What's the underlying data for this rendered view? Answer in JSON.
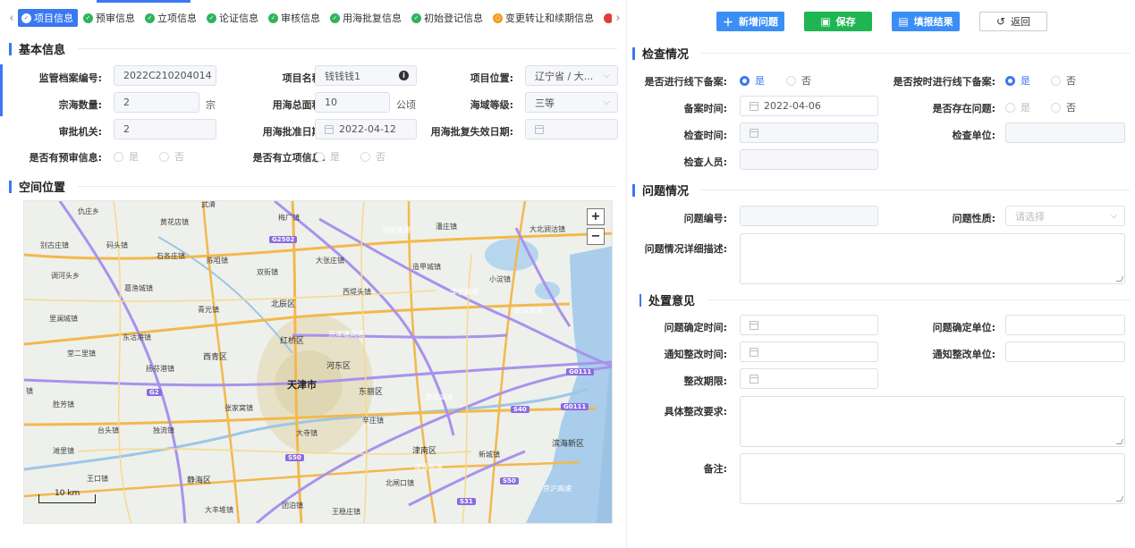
{
  "tabs": [
    {
      "label": "项目信息",
      "icon": "check-circle-icon",
      "active": true
    },
    {
      "label": "预审信息",
      "icon": "check-circle-icon"
    },
    {
      "label": "立项信息",
      "icon": "check-circle-icon"
    },
    {
      "label": "论证信息",
      "icon": "check-circle-icon"
    },
    {
      "label": "审核信息",
      "icon": "check-circle-icon"
    },
    {
      "label": "用海批复信息",
      "icon": "check-circle-icon"
    },
    {
      "label": "初始登记信息",
      "icon": "check-circle-icon"
    },
    {
      "label": "变更转让和续期信息",
      "icon": "pending-circle-icon"
    }
  ],
  "basic": {
    "title": "基本信息",
    "archive_no_label": "监管档案编号:",
    "archive_no": "2022C210204014",
    "project_name_label": "项目名称:",
    "project_name": "钱钱钱1",
    "location_label": "项目位置:",
    "location": "辽宁省 / 大...",
    "count_label": "宗海数量:",
    "count": "2",
    "count_unit": "宗",
    "area_label": "用海总面积:",
    "area": "10",
    "area_unit": "公顷",
    "grade_label": "海域等级:",
    "grade": "三等",
    "authority_label": "审批机关:",
    "authority": "2",
    "approve_date_label": "用海批准日期:",
    "approve_date": "2022-04-12",
    "expire_date_label": "用海批复失效日期:",
    "expire_date": "",
    "has_preview_label": "是否有预审信息:",
    "has_project_label": "是否有立项信息:",
    "yes": "是",
    "no": "否"
  },
  "space": {
    "title": "空间位置",
    "scale_label": "10 km",
    "zoom_in": "+",
    "zoom_out": "−",
    "places": [
      {
        "t": "武清",
        "cls": ""
      },
      {
        "t": "仇庄乡",
        "cls": ""
      },
      {
        "t": "黄花店镇",
        "cls": ""
      },
      {
        "t": "梅厂镇",
        "cls": ""
      },
      {
        "t": "潘庄镇",
        "cls": ""
      },
      {
        "t": "大北涧沽镇",
        "cls": ""
      },
      {
        "t": "别古庄镇",
        "cls": ""
      },
      {
        "t": "码头镇",
        "cls": ""
      },
      {
        "t": "石各庄镇",
        "cls": ""
      },
      {
        "t": "陈咀镇",
        "cls": ""
      },
      {
        "t": "大张庄镇",
        "cls": ""
      },
      {
        "t": "造甲城镇",
        "cls": ""
      },
      {
        "t": "调河头乡",
        "cls": ""
      },
      {
        "t": "双街镇",
        "cls": ""
      },
      {
        "t": "葛渔城镇",
        "cls": ""
      },
      {
        "t": "小淀镇",
        "cls": ""
      },
      {
        "t": "西堤头镇",
        "cls": ""
      },
      {
        "t": "北辰区",
        "cls": "district"
      },
      {
        "t": "青光镇",
        "cls": ""
      },
      {
        "t": "里澜城镇",
        "cls": ""
      },
      {
        "t": "东沽港镇",
        "cls": ""
      },
      {
        "t": "红桥区",
        "cls": "district"
      },
      {
        "t": "堂二里镇",
        "cls": ""
      },
      {
        "t": "西青区",
        "cls": "district"
      },
      {
        "t": "河东区",
        "cls": "district"
      },
      {
        "t": "扬芬港镇",
        "cls": ""
      },
      {
        "t": "天津市",
        "cls": "city"
      },
      {
        "t": "东丽区",
        "cls": "district"
      },
      {
        "t": "胜芳镇",
        "cls": ""
      },
      {
        "t": "张家窝镇",
        "cls": ""
      },
      {
        "t": "辛庄镇",
        "cls": ""
      },
      {
        "t": "台头镇",
        "cls": ""
      },
      {
        "t": "独流镇",
        "cls": ""
      },
      {
        "t": "大寺镇",
        "cls": ""
      },
      {
        "t": "滨海新区",
        "cls": "district"
      },
      {
        "t": "津南区",
        "cls": "district"
      },
      {
        "t": "新城镇",
        "cls": ""
      },
      {
        "t": "滩里镇",
        "cls": ""
      },
      {
        "t": "王口镇",
        "cls": ""
      },
      {
        "t": "静海区",
        "cls": "district"
      },
      {
        "t": "北闸口镇",
        "cls": ""
      },
      {
        "t": "大丰堆镇",
        "cls": ""
      },
      {
        "t": "团泊镇",
        "cls": ""
      },
      {
        "t": "王稳庄镇",
        "cls": ""
      },
      {
        "t": "镇",
        "cls": ""
      }
    ],
    "shields": [
      "G2502",
      "G0111",
      "G2",
      "G0111",
      "S40",
      "S50",
      "S50",
      "S31"
    ],
    "road_labels": [
      "滨保高速",
      "津宁高速",
      "长深高速",
      "京津塘高速",
      "津滨高速",
      "津晋高速",
      "京沪高速"
    ]
  },
  "toolbar": {
    "add_label": "新增问题",
    "save_label": "保存",
    "report_label": "填报结果",
    "back_label": "返回"
  },
  "inspect": {
    "title": "检查情况",
    "offline_label": "是否进行线下备案:",
    "ontime_label": "是否按时进行线下备案:",
    "record_time_label": "备案时间:",
    "record_time": "2022-04-06",
    "has_problem_label": "是否存在问题:",
    "check_time_label": "检查时间:",
    "check_unit_label": "检查单位:",
    "checker_label": "检查人员:",
    "yes": "是",
    "no": "否"
  },
  "problem": {
    "title": "问题情况",
    "no_label": "问题编号:",
    "nature_label": "问题性质:",
    "nature_placeholder": "请选择",
    "desc_label": "问题情况详细描述:"
  },
  "handle": {
    "title": "处置意见",
    "confirm_time_label": "问题确定时间:",
    "confirm_unit_label": "问题确定单位:",
    "notify_time_label": "通知整改时间:",
    "notify_unit_label": "通知整改单位:",
    "deadline_label": "整改期限:",
    "require_label": "具体整改要求:",
    "remark_label": "备注:"
  },
  "colors": {
    "primary": "#3a78f2",
    "success": "#1fb553",
    "check": "#2fb35c"
  }
}
